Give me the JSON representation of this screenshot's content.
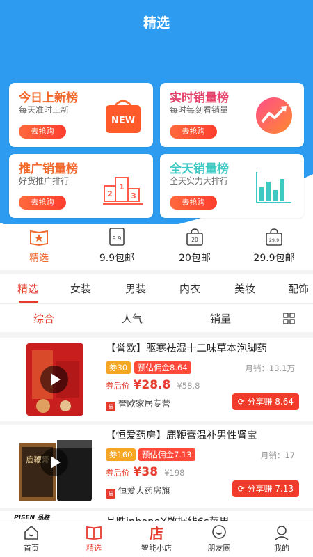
{
  "header": {
    "title": "精选"
  },
  "cards": [
    {
      "title": "今日上新榜",
      "subtitle": "每天准时上新",
      "button": "去抢购",
      "title_color": "#f2692e",
      "icon": "new-bag-icon",
      "badge": "NEW"
    },
    {
      "title": "实时销量榜",
      "subtitle": "每时每刻看销量",
      "button": "去抢购",
      "title_color": "#e5436b",
      "icon": "trend-up-icon"
    },
    {
      "title": "推广销量榜",
      "subtitle": "好货推广排行",
      "button": "去抢购",
      "title_color": "#f2692e",
      "icon": "podium-icon",
      "podium": [
        "2",
        "1",
        "3"
      ]
    },
    {
      "title": "全天销量榜",
      "subtitle": "全天实力大排行",
      "button": "去抢购",
      "title_color": "#3ec9c3",
      "icon": "bar-chart-icon"
    }
  ],
  "quick": [
    {
      "label": "精选",
      "icon": "star-book-icon",
      "icon_text": ""
    },
    {
      "label": "9.9包邮",
      "icon": "price-tag-icon",
      "icon_text": "9.9"
    },
    {
      "label": "20包邮",
      "icon": "bag-icon",
      "icon_text": "20"
    },
    {
      "label": "29.9包邮",
      "icon": "bag-icon",
      "icon_text": "29.9"
    }
  ],
  "tabs": [
    "精选",
    "女装",
    "男装",
    "内衣",
    "美妆",
    "配饰"
  ],
  "sorts": [
    "综合",
    "人气",
    "销量"
  ],
  "products": [
    {
      "title": "【誉欧】驱寒祛湿十二味草本泡脚药",
      "coupon": "券30",
      "commission": "预估佣金8.64",
      "sales": "月销：13.1万",
      "price_label": "券后价",
      "price": "¥28.8",
      "orig_price": "¥58.8",
      "shop": "誉欧家居专营",
      "share": "分享赚 8.64"
    },
    {
      "title": "【恒爱药房】鹿鞭膏温补男性肾宝",
      "coupon": "券160",
      "commission": "预估佣金7.13",
      "sales": "月销：17",
      "price_label": "券后价",
      "price": "¥38",
      "orig_price": "¥198",
      "shop": "恒爱大药房旗",
      "share": "分享赚 7.13",
      "product_text": "鹿鞭膏"
    },
    {
      "title": "品胜iphoneX数据线6s苹果",
      "brand": "PISEN 品胜"
    }
  ],
  "nav": [
    {
      "label": "首页",
      "icon": "home-icon"
    },
    {
      "label": "精选",
      "icon": "book-icon"
    },
    {
      "label": "智能小店",
      "icon": "store-icon",
      "icon_text": "店"
    },
    {
      "label": "朋友圈",
      "icon": "chat-bubble-icon"
    },
    {
      "label": "我的",
      "icon": "user-icon"
    }
  ],
  "theme": {
    "primary": "#2d9cf0",
    "accent": "#e63b2e",
    "coupon": "#f5a623"
  }
}
